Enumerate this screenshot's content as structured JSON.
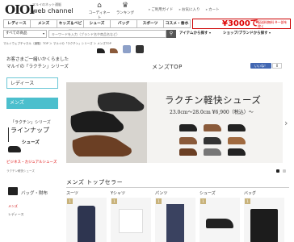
{
  "header": {
    "logo_marks": "OIOI",
    "logo_sub": "マルイのネット通販",
    "logo_text": "web channel",
    "icons": [
      {
        "name": "coordinate",
        "label": "コーディネート",
        "glyph": "⌂"
      },
      {
        "name": "ranking",
        "label": "ランキング",
        "glyph": "♛"
      }
    ],
    "links": [
      "ご利用ガイド",
      "お気に入り",
      "カート"
    ]
  },
  "category_nav": [
    "レディース",
    "メンズ",
    "キッズ＆ベビー",
    "シューズ",
    "バッグ",
    "スポーツ",
    "コスメ・香水"
  ],
  "promo": {
    "big": "¥3000で",
    "small": "配送料無料 ※一部を除く"
  },
  "search": {
    "select_value": "すべての商品",
    "placeholder": "キーワードを入力（ブランド名や商品名など）",
    "button_icon": "search-icon",
    "filters": [
      "アイテムから探す",
      "ショップ/ブランドから探す"
    ]
  },
  "breadcrumb": "マルイウェブチャネル（通販）TOP ＞ マルイの「ラクチン」シリーズ ＞ メンズTOP",
  "page_title": "メンズTOP",
  "like": {
    "label": "いいね！",
    "count": "0"
  },
  "sidebar": {
    "welcome_lines": [
      "お客さまご一緒いかくらました",
      "マルイの「ラクチン」シリーズ"
    ],
    "ladies": "レディース",
    "mens": "メンズ",
    "lineup_l1": "「ラクチン」シリーズ",
    "lineup_l2": "ラインナップ",
    "lineup_l3": "シューズ",
    "red_link": "ビジネス・カジュアルシューズ",
    "gray_small": "ラクチン軽快シューズ",
    "bag_label": "バッグ・財布",
    "mini_links": [
      "メンズ",
      "レディース"
    ]
  },
  "banner": {
    "title": "ラクチン軽快シューズ",
    "sub": "23.0cm～28.0cm ¥6,900（税込）～",
    "next": "›"
  },
  "top_sellers": {
    "heading": "メンズ トップセラー",
    "columns": [
      "スーツ",
      "Yシャツ",
      "パンツ",
      "シューズ",
      "バッグ"
    ]
  },
  "colors": {
    "accent": "#4cbfcd",
    "promo_red": "#d00000",
    "like_blue": "#4267b2"
  }
}
